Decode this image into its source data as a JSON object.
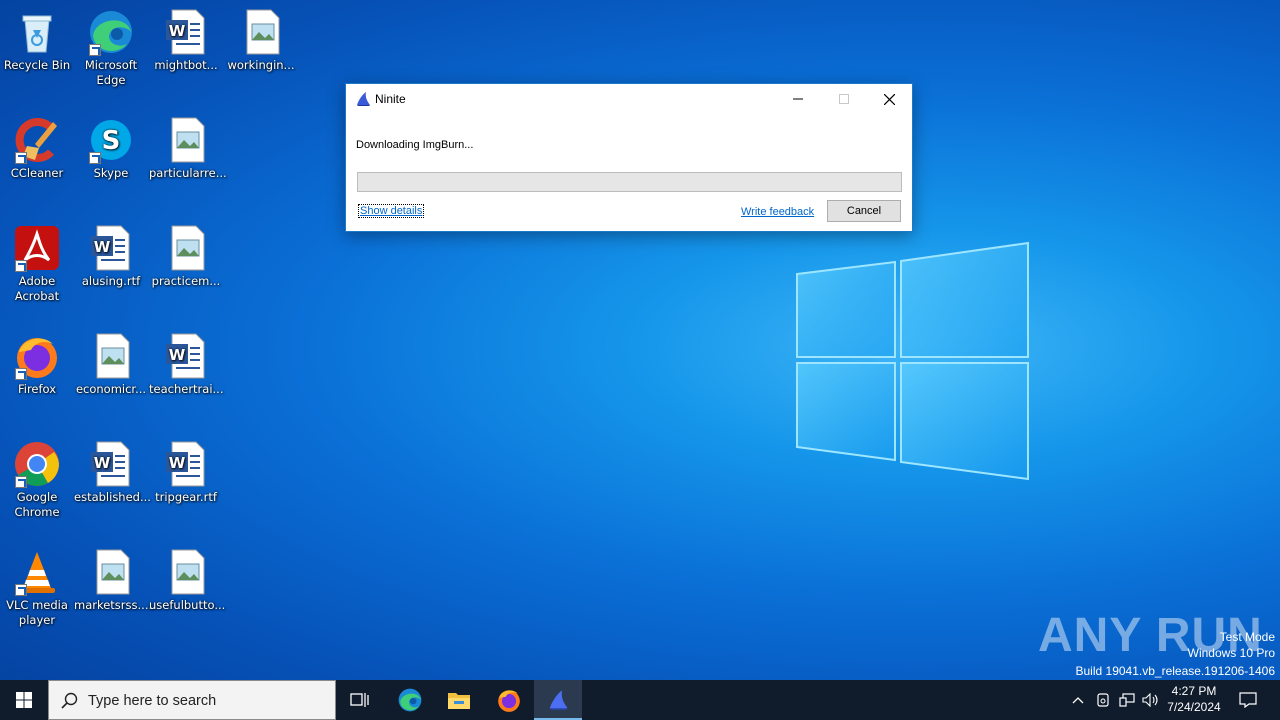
{
  "desktop": {
    "icons": [
      {
        "label": "Recycle Bin",
        "icon": "recycle-bin-icon"
      },
      {
        "label": "Microsoft Edge",
        "icon": "edge-icon"
      },
      {
        "label": "mightbot...",
        "icon": "word-doc-icon"
      },
      {
        "label": "workingin...",
        "icon": "image-file-icon"
      },
      {
        "label": "CCleaner",
        "icon": "ccleaner-icon"
      },
      {
        "label": "Skype",
        "icon": "skype-icon"
      },
      {
        "label": "particularre...",
        "icon": "image-file-icon"
      },
      {
        "label": "Adobe Acrobat",
        "icon": "acrobat-icon"
      },
      {
        "label": "alusing.rtf",
        "icon": "word-doc-icon"
      },
      {
        "label": "practicem...",
        "icon": "image-file-icon"
      },
      {
        "label": "Firefox",
        "icon": "firefox-icon"
      },
      {
        "label": "economicr...",
        "icon": "image-file-icon"
      },
      {
        "label": "teachertrai...",
        "icon": "word-doc-icon"
      },
      {
        "label": "Google Chrome",
        "icon": "chrome-icon"
      },
      {
        "label": "established...",
        "icon": "word-doc-icon"
      },
      {
        "label": "tripgear.rtf",
        "icon": "word-doc-icon"
      },
      {
        "label": "VLC media player",
        "icon": "vlc-icon"
      },
      {
        "label": "marketsrss....",
        "icon": "image-file-icon"
      },
      {
        "label": "usefulbutto...",
        "icon": "image-file-icon"
      }
    ]
  },
  "dialog": {
    "title": "Ninite",
    "status_text": "Downloading ImgBurn...",
    "progress": 0,
    "show_details_label": "Show details",
    "write_feedback_label": "Write feedback",
    "cancel_label": "Cancel"
  },
  "watermark": {
    "logo_text": "ANY RUN",
    "line1": "Test Mode",
    "line2": "Windows 10 Pro",
    "line3": "Build 19041.vb_release.191206-1406"
  },
  "taskbar": {
    "search_placeholder": "Type here to search",
    "apps": [
      "task-view-icon",
      "edge-icon",
      "file-explorer-icon",
      "firefox-icon",
      "ninite-icon"
    ],
    "active_app": "ninite-icon",
    "time": "4:27 PM",
    "date": "7/24/2024"
  },
  "colors": {
    "accent": "#0078d7",
    "taskbar": "#101c2c",
    "link": "#0066cc"
  }
}
